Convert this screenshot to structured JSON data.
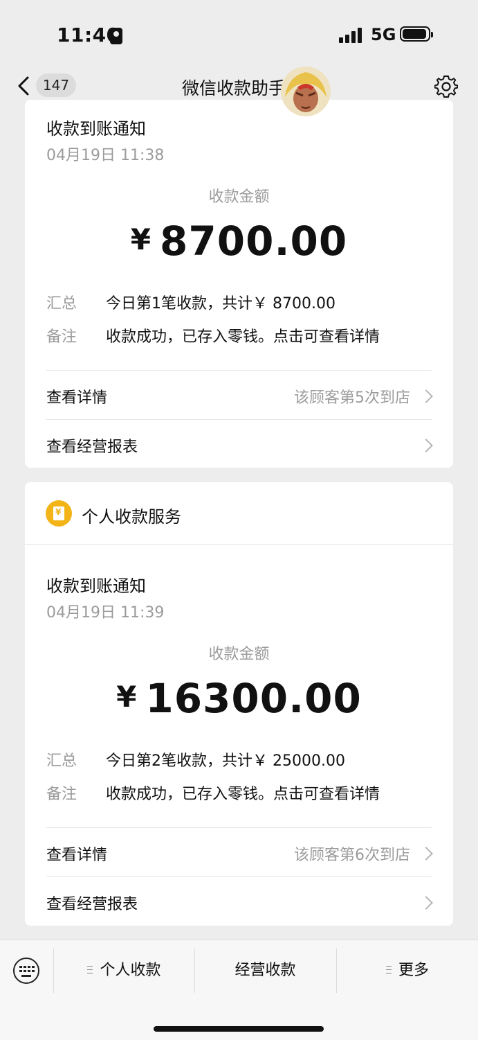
{
  "status_bar": {
    "time": "11:40",
    "network": "5G"
  },
  "nav": {
    "unread_count": "147",
    "title": "微信收款助手"
  },
  "notifications": [
    {
      "title": "收款到账通知",
      "date": "04月19日 11:38",
      "amount_label": "收款金额",
      "currency": "¥",
      "amount": "8700.00",
      "summary_label": "汇总",
      "summary": "今日第1笔收款，共计￥ 8700.00",
      "note_label": "备注",
      "note": "收款成功，已存入零钱。点击可查看详情",
      "details_label": "查看详情",
      "details_hint": "该顾客第5次到店",
      "report_label": "查看经营报表"
    },
    {
      "title": "收款到账通知",
      "date": "04月19日 11:39",
      "amount_label": "收款金额",
      "currency": "¥",
      "amount": "16300.00",
      "summary_label": "汇总",
      "summary": "今日第2笔收款，共计￥ 25000.00",
      "note_label": "备注",
      "note": "收款成功，已存入零钱。点击可查看详情",
      "details_label": "查看详情",
      "details_hint": "该顾客第6次到店",
      "report_label": "查看经营报表"
    }
  ],
  "service": {
    "name": "个人收款服务",
    "icon": "wallet-icon",
    "color": "#f2b417"
  },
  "bottom_menu": {
    "items": [
      "个人收款",
      "经营收款",
      "更多"
    ]
  }
}
